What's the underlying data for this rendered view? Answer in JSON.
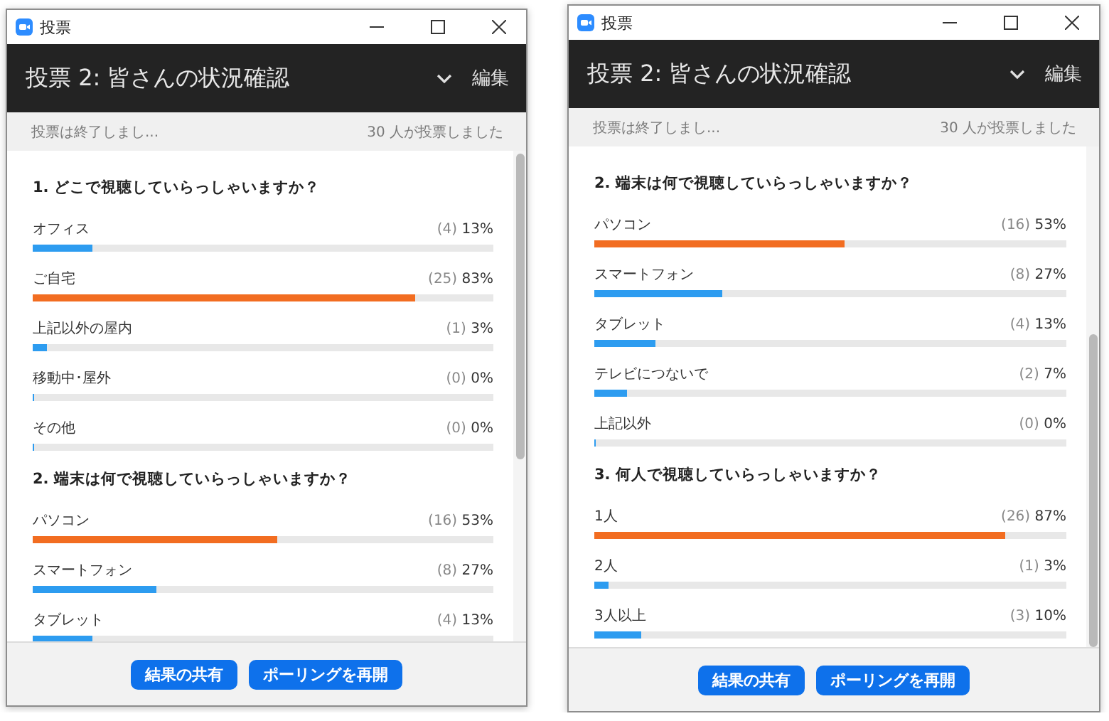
{
  "windows": [
    {
      "title": "投票",
      "header": {
        "title": "投票 2: 皆さんの状況確認",
        "edit": "編集"
      },
      "status": {
        "left": "投票は終了しまし...",
        "right": "30 人が投票しました"
      },
      "questions": [
        {
          "title": "1. どこで視聴していらっしゃいますか？",
          "options": [
            {
              "label": "オフィス",
              "count": "(4)",
              "percent": "13%",
              "level": 0.13,
              "leading": false
            },
            {
              "label": "ご自宅",
              "count": "(25)",
              "percent": "83%",
              "level": 0.83,
              "leading": true
            },
            {
              "label": "上記以外の屋内",
              "count": "(1)",
              "percent": "3%",
              "level": 0.03,
              "leading": false
            },
            {
              "label": "移動中･屋外",
              "count": "(0)",
              "percent": "0%",
              "level": 0,
              "leading": false
            },
            {
              "label": "その他",
              "count": "(0)",
              "percent": "0%",
              "level": 0,
              "leading": false
            }
          ]
        },
        {
          "title": "2. 端末は何で視聴していらっしゃいますか？",
          "options": [
            {
              "label": "パソコン",
              "count": "(16)",
              "percent": "53%",
              "level": 0.53,
              "leading": true
            },
            {
              "label": "スマートフォン",
              "count": "(8)",
              "percent": "27%",
              "level": 0.27,
              "leading": false
            },
            {
              "label": "タブレット",
              "count": "(4)",
              "percent": "13%",
              "level": 0.13,
              "leading": false
            }
          ]
        }
      ],
      "buttons": [
        "結果の共有",
        "ポーリングを再開"
      ]
    },
    {
      "title": "投票",
      "header": {
        "title": "投票 2: 皆さんの状況確認",
        "edit": "編集"
      },
      "status": {
        "left": "投票は終了しまし...",
        "right": "30 人が投票しました"
      },
      "questions": [
        {
          "title": "2. 端末は何で視聴していらっしゃいますか？",
          "options": [
            {
              "label": "パソコン",
              "count": "(16)",
              "percent": "53%",
              "level": 0.53,
              "leading": true
            },
            {
              "label": "スマートフォン",
              "count": "(8)",
              "percent": "27%",
              "level": 0.27,
              "leading": false
            },
            {
              "label": "タブレット",
              "count": "(4)",
              "percent": "13%",
              "level": 0.13,
              "leading": false
            },
            {
              "label": "テレビにつないで",
              "count": "(2)",
              "percent": "7%",
              "level": 0.07,
              "leading": false
            },
            {
              "label": "上記以外",
              "count": "(0)",
              "percent": "0%",
              "level": 0,
              "leading": false
            }
          ]
        },
        {
          "title": "3. 何人で視聴していらっしゃいますか？",
          "options": [
            {
              "label": "1人",
              "count": "(26)",
              "percent": "87%",
              "level": 0.87,
              "leading": true
            },
            {
              "label": "2人",
              "count": "(1)",
              "percent": "3%",
              "level": 0.03,
              "leading": false
            },
            {
              "label": "3人以上",
              "count": "(3)",
              "percent": "10%",
              "level": 0.1,
              "leading": false
            }
          ]
        }
      ],
      "buttons": [
        "結果の共有",
        "ポーリングを再開"
      ]
    }
  ]
}
